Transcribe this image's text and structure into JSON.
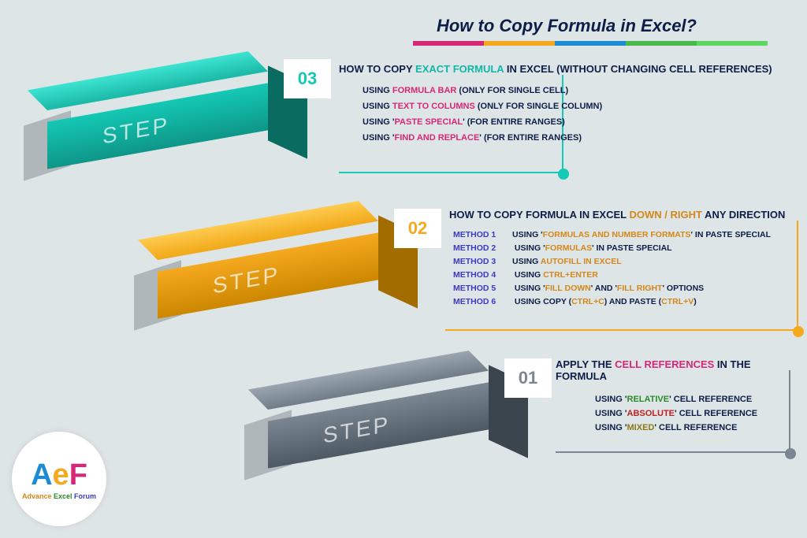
{
  "title": "How to Copy Formula in Excel?",
  "colorbar": [
    "#d62876",
    "#f5a91f",
    "#1b8bd6",
    "#4ab84a",
    "#5fd65f"
  ],
  "steps": {
    "s03": {
      "label": "STEP",
      "num": "03"
    },
    "s02": {
      "label": "STEP",
      "num": "02"
    },
    "s01": {
      "label": "STEP",
      "num": "01"
    }
  },
  "c03": {
    "heading_pre": "HOW TO COPY ",
    "heading_hl": "EXACT FORMULA",
    "heading_post": " IN EXCEL (WITHOUT CHANGING CELL REFERENCES)",
    "i1_pre": "USING ",
    "i1_hl": "FORMULA BAR",
    "i1_post": " (ONLY FOR SINGLE CELL)",
    "i2_pre": "USING ",
    "i2_hl": "TEXT TO COLUMNS",
    "i2_post": " (ONLY FOR SINGLE COLUMN)",
    "i3_pre": "USING '",
    "i3_hl": "PASTE SPECIAL",
    "i3_post": "' (FOR ENTIRE RANGES)",
    "i4_pre": "USING '",
    "i4_hl": "FIND AND REPLACE",
    "i4_post": "' (FOR ENTIRE RANGES)"
  },
  "c02": {
    "heading_pre": "HOW TO COPY FORMULA IN EXCEL ",
    "heading_hl": "DOWN / RIGHT",
    "heading_post": " ANY DIRECTION",
    "m1_label": "METHOD 1",
    "m1_pre": "USING '",
    "m1_hl": "FORMULAS AND NUMBER FORMATS",
    "m1_post": "' IN PASTE SPECIAL",
    "m2_label": "METHOD 2",
    "m2_pre": "USING '",
    "m2_hl": "FORMULAS",
    "m2_post": "' IN PASTE SPECIAL",
    "m3_label": "METHOD 3",
    "m3_pre": "USING ",
    "m3_hl": "AUTOFILL IN EXCEL",
    "m3_post": "",
    "m4_label": "METHOD 4",
    "m4_pre": "USING ",
    "m4_hl": "CTRL+ENTER",
    "m4_post": "",
    "m5_label": "METHOD 5",
    "m5_pre": "USING '",
    "m5_hl1": "FILL DOWN",
    "m5_mid": "' AND '",
    "m5_hl2": "FILL RIGHT",
    "m5_post": "' OPTIONS",
    "m6_label": "METHOD 6",
    "m6_pre": "USING COPY (",
    "m6_hl1": "CTRL+C",
    "m6_mid": ") AND PASTE (",
    "m6_hl2": "CTRL+V",
    "m6_post": ")"
  },
  "c01": {
    "heading_pre": "APPLY THE ",
    "heading_hl": "CELL REFERENCES",
    "heading_post": " IN THE FORMULA",
    "i1_pre": "USING '",
    "i1_hl": "RELATIVE",
    "i1_post": "' CELL REFERENCE",
    "i2_pre": "USING '",
    "i2_hl": "ABSOLUTE",
    "i2_post": "' CELL REFERENCE",
    "i3_pre": "USING '",
    "i3_hl": "MIXED",
    "i3_post": "' CELL REFERENCE"
  },
  "logo": {
    "a": "A",
    "e": "e",
    "f": "F",
    "text_a": "Advance ",
    "text_e": "Excel ",
    "text_f": "Forum"
  }
}
